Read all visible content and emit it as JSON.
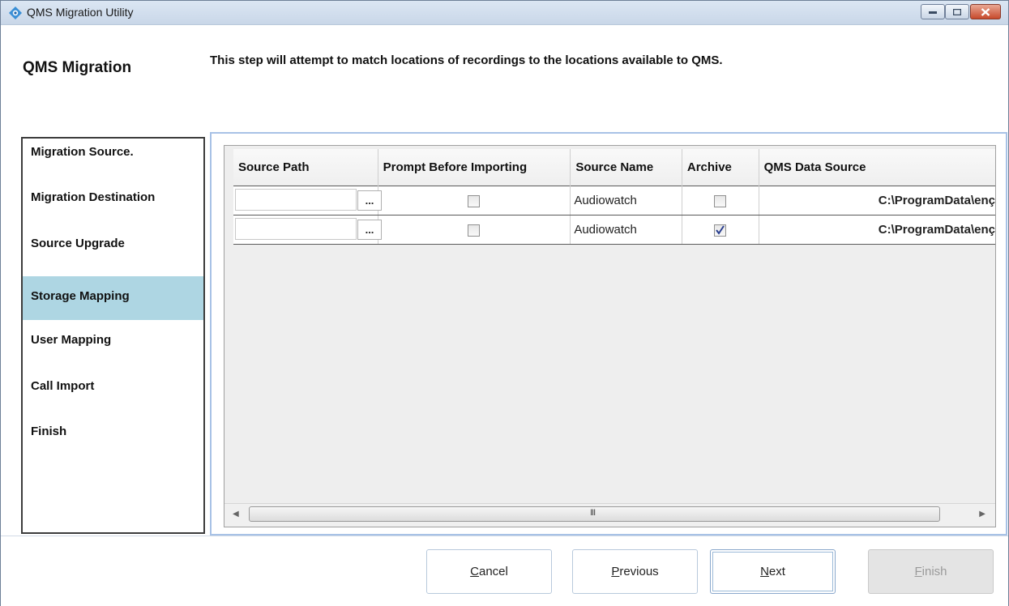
{
  "window": {
    "title": "QMS Migration Utility"
  },
  "header": {
    "title": "QMS Migration",
    "description": "This step will attempt to match locations of recordings to the locations available to QMS."
  },
  "nav": {
    "items": [
      {
        "label": "Migration Source.",
        "active": false
      },
      {
        "label": "Migration Destination",
        "active": false
      },
      {
        "label": "Source Upgrade",
        "active": false
      },
      {
        "label": "Storage Mapping",
        "active": true
      },
      {
        "label": "User Mapping",
        "active": false
      },
      {
        "label": "Call Import",
        "active": false
      },
      {
        "label": "Finish",
        "active": false
      }
    ]
  },
  "grid": {
    "columns": [
      "Source Path",
      "Prompt Before Importing",
      "Source Name",
      "Archive",
      "QMS Data Source"
    ],
    "rows": [
      {
        "source_path": "",
        "browse_label": "...",
        "prompt_before_importing": false,
        "source_name": "Audiowatch",
        "archive": false,
        "qms_data_source": "C:\\ProgramData\\enç"
      },
      {
        "source_path": "",
        "browse_label": "...",
        "prompt_before_importing": false,
        "source_name": "Audiowatch",
        "archive": true,
        "qms_data_source": "C:\\ProgramData\\enç"
      }
    ],
    "scroll_grip": "III"
  },
  "footer": {
    "cancel_first": "C",
    "cancel_rest": "ancel",
    "previous_first": "P",
    "previous_rest": "revious",
    "next_first": "N",
    "next_rest": "ext",
    "finish_first": "F",
    "finish_rest": "inish"
  }
}
